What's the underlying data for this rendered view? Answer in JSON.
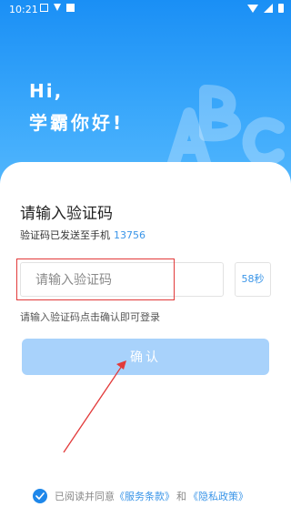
{
  "status_bar": {
    "time": "10:21"
  },
  "hero": {
    "greeting_line1": "Hi,",
    "greeting_line2": "学霸你好!"
  },
  "form": {
    "title": "请输入验证码",
    "sent_to_label": "验证码已发送至手机",
    "phone_suffix": "13756",
    "code_placeholder": "请输入验证码",
    "countdown": "58秒",
    "hint": "请输入验证码点击确认即可登录",
    "confirm_label": "确认"
  },
  "agreement": {
    "prefix": "已阅读并同意",
    "terms": "《服务条款》",
    "and": "和",
    "privacy": "《隐私政策》",
    "checked": true
  },
  "colors": {
    "primary": "#1e87ea",
    "hero": "#2a9cf8",
    "button_disabled": "#a8d2fb",
    "annotation": "#e23a3a"
  }
}
